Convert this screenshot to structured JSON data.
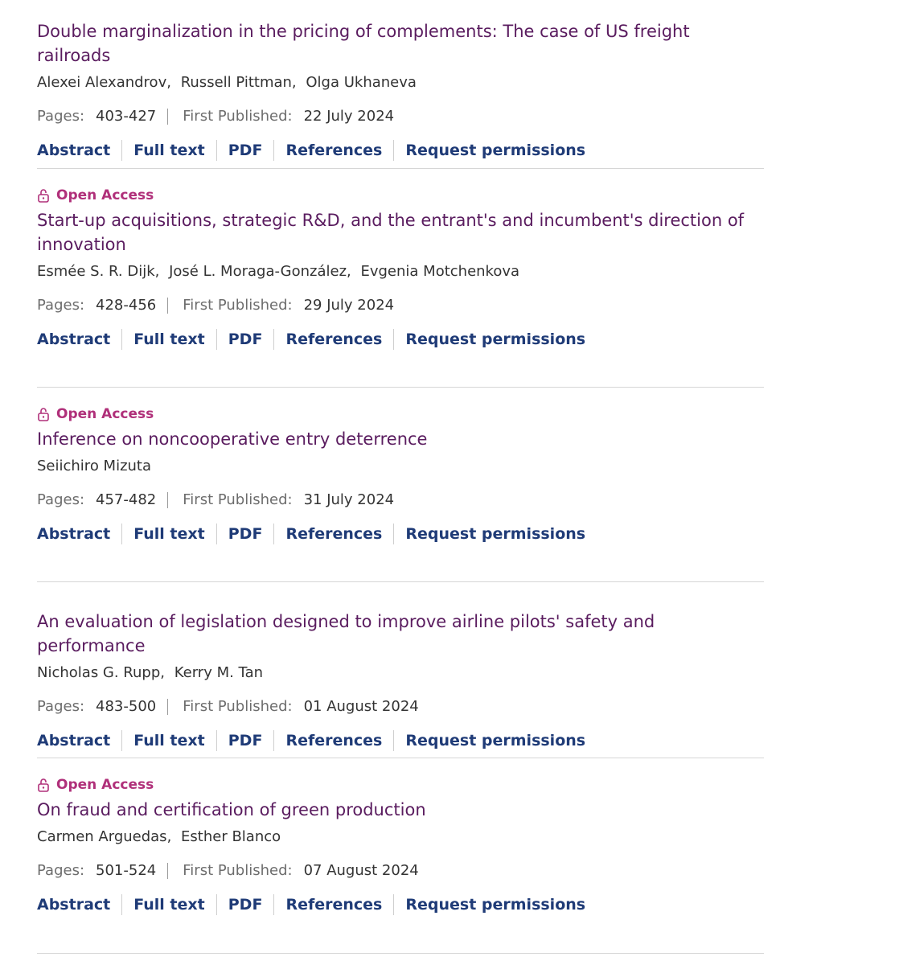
{
  "labels": {
    "pages": "Pages:",
    "first_published": "First Published:",
    "open_access": "Open Access"
  },
  "links": [
    "Abstract",
    "Full text",
    "PDF",
    "References",
    "Request permissions"
  ],
  "articles": [
    {
      "open_access": false,
      "title": "Double marginalization in the pricing of complements: The case of US freight railroads",
      "authors": [
        "Alexei Alexandrov",
        "Russell Pittman",
        "Olga Ukhaneva"
      ],
      "pages": "403-427",
      "date": "22 July 2024"
    },
    {
      "open_access": true,
      "title": "Start-up acquisitions, strategic R&D, and the entrant's and incumbent's direction of innovation",
      "authors": [
        "Esmée S. R. Dijk",
        "José L. Moraga-González",
        "Evgenia Motchenkova"
      ],
      "pages": "428-456",
      "date": "29 July 2024"
    },
    {
      "open_access": true,
      "title": "Inference on noncooperative entry deterrence",
      "authors": [
        "Seiichiro Mizuta"
      ],
      "pages": "457-482",
      "date": "31 July 2024"
    },
    {
      "open_access": false,
      "title": "An evaluation of legislation designed to improve airline pilots' safety and performance",
      "authors": [
        "Nicholas G. Rupp",
        "Kerry M. Tan"
      ],
      "pages": "483-500",
      "date": "01 August 2024"
    },
    {
      "open_access": true,
      "title": "On fraud and certification of green production",
      "authors": [
        "Carmen Arguedas",
        "Esther Blanco"
      ],
      "pages": "501-524",
      "date": "07 August 2024"
    }
  ],
  "colors": {
    "title": "#5a1c5f",
    "link": "#1f3b77",
    "open_access": "#b0307a"
  }
}
